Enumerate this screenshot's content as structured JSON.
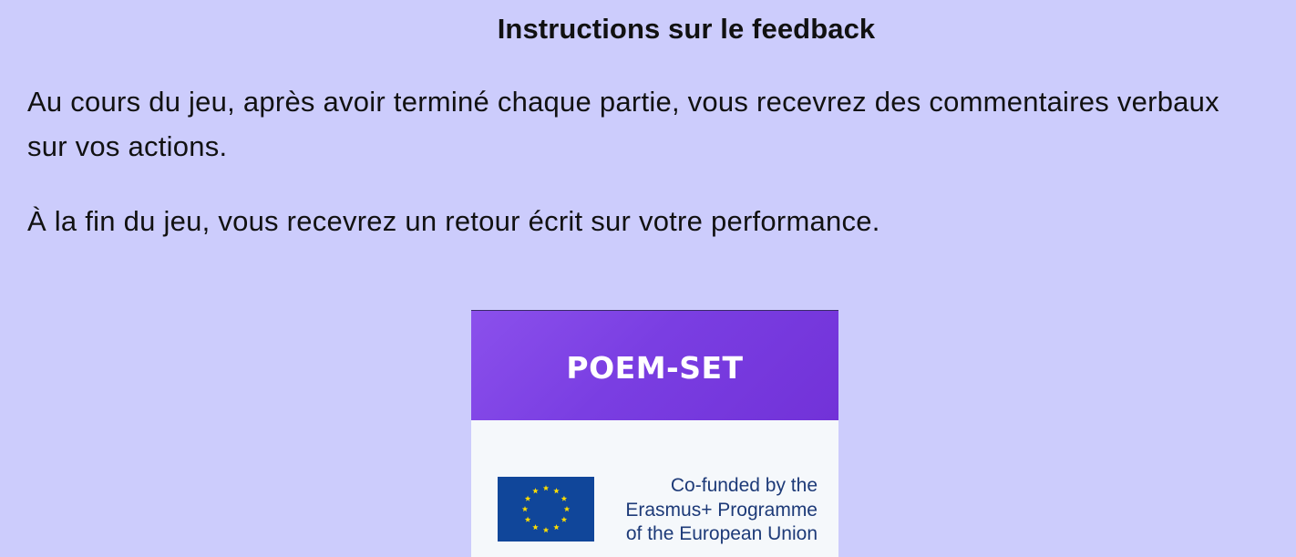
{
  "heading": "Instructions sur le feedback",
  "paragraphs": [
    "Au cours du jeu, après avoir terminé chaque partie, vous recevrez des commentaires verbaux sur vos actions.",
    "À la fin du jeu, vous recevrez un retour écrit sur votre performance."
  ],
  "card": {
    "title": "POEM-SET",
    "header_color": "#7a3ee2",
    "eu_logo": {
      "icon": "eu-flag-icon",
      "lines": [
        "Co-funded by the",
        "Erasmus+ Programme",
        "of the European Union"
      ]
    }
  },
  "colors": {
    "background": "#ccccfc",
    "text": "#111111",
    "eu_blue": "#10469a",
    "eu_star": "#ffde00"
  }
}
